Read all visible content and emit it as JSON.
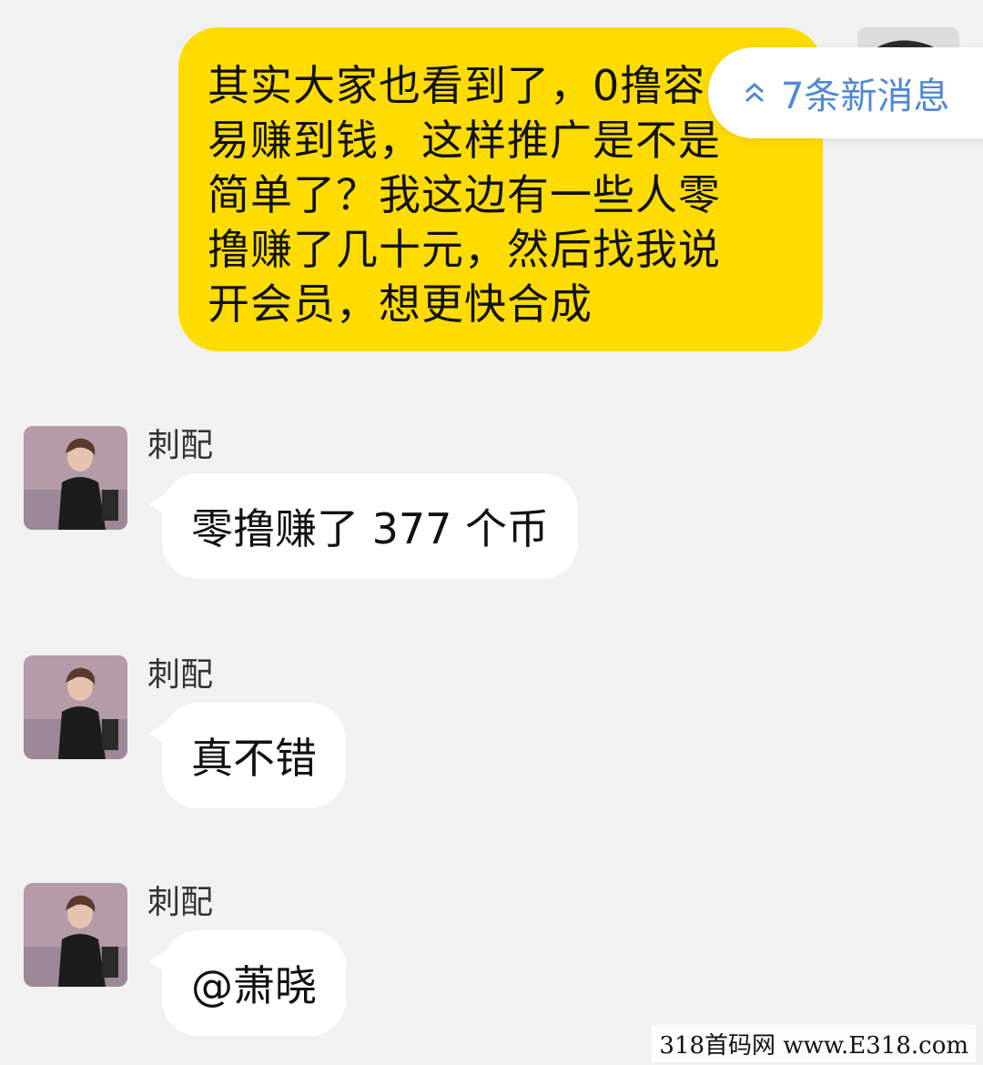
{
  "outgoing": {
    "text": "其实大家也看到了，0撸容\n易赚到钱，这样推广是不是\n简单了？我这边有一些人零\n撸赚了几十元，然后找我说\n开会员，想更快合成"
  },
  "new_messages": {
    "label": "7条新消息",
    "icon": "double-chevron-up-icon",
    "color": "#4f88d6"
  },
  "incoming": [
    {
      "sender": "刺配",
      "text": "零撸赚了 377 个币"
    },
    {
      "sender": "刺配",
      "text": "真不错"
    },
    {
      "sender": "刺配",
      "text": "@萧晓"
    }
  ],
  "watermark": "318首码网 www.E318.com",
  "colors": {
    "bubble_out": "#fedc00",
    "bubble_in": "#ffffff",
    "background": "#f1f1f1"
  }
}
